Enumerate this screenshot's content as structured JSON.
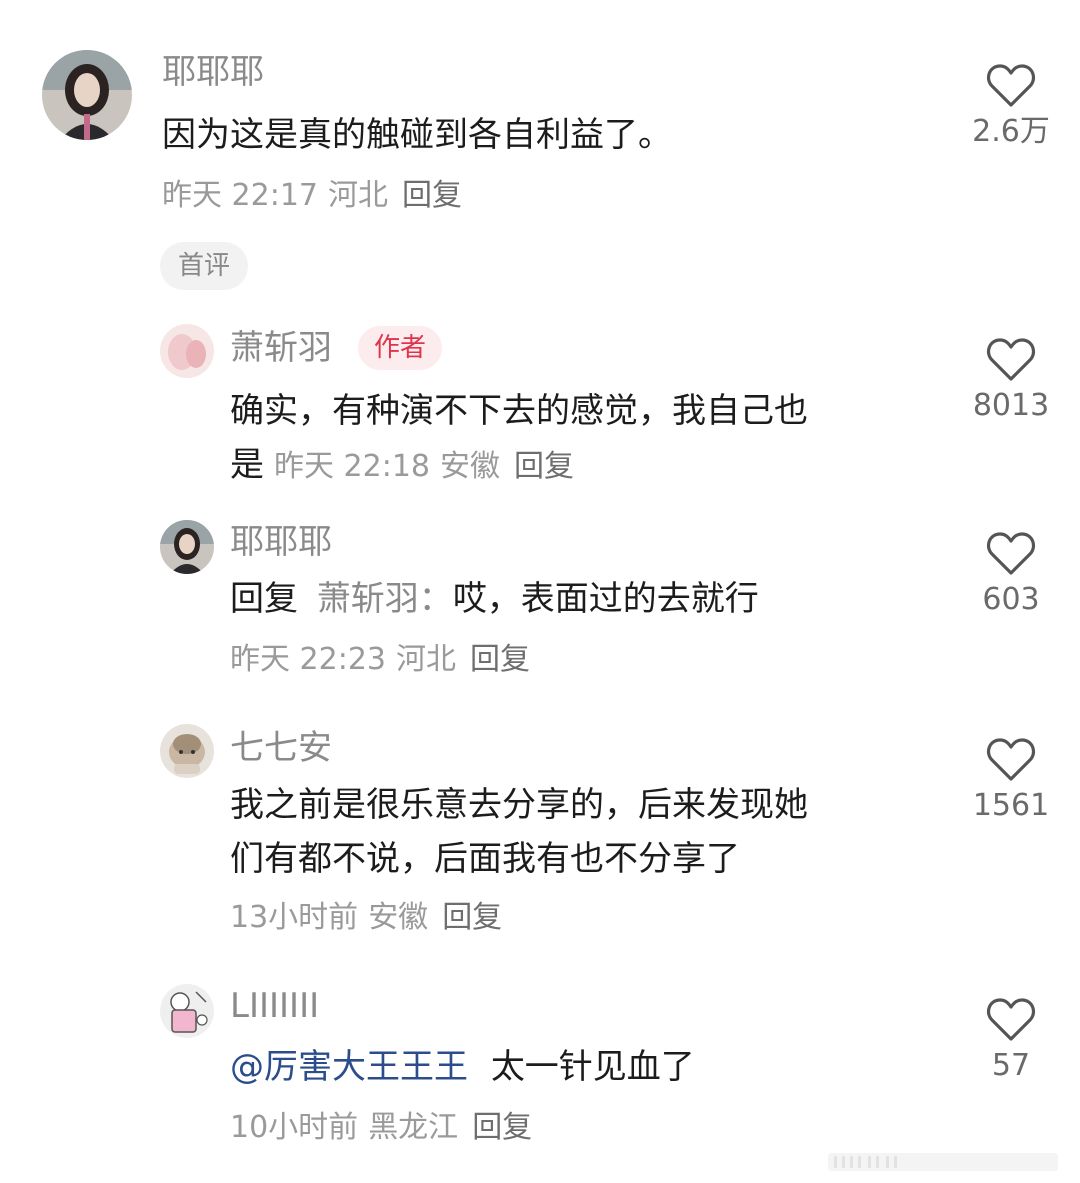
{
  "comments": [
    {
      "username": "耶耶耶",
      "text": "因为这是真的触碰到各自利益了。",
      "time": "昨天 22:17",
      "location": "河北",
      "reply_label": "回复",
      "likes": "2.6万",
      "tag": "首评"
    },
    {
      "username": "萧斩羽",
      "badge": "作者",
      "text_line1": "确实，有种演不下去的感觉，我自己也",
      "text_line2": "是",
      "time": "昨天 22:18",
      "location": "安徽",
      "reply_label": "回复",
      "likes": "8013"
    },
    {
      "username": "耶耶耶",
      "reply_prefix": "回复",
      "reply_target": "萧斩羽：",
      "text": "哎，表面过的去就行",
      "time": "昨天 22:23",
      "location": "河北",
      "reply_label": "回复",
      "likes": "603"
    },
    {
      "username": "七七安",
      "text_line1": "我之前是很乐意去分享的，后来发现她",
      "text_line2": "们有都不说，后面我有也不分享了",
      "time": "13小时前",
      "location": "安徽",
      "reply_label": "回复",
      "likes": "1561"
    },
    {
      "username": "LIIIIIII",
      "mention": "@厉害大王王王",
      "text": "太一针见血了",
      "time": "10小时前",
      "location": "黑龙江",
      "reply_label": "回复",
      "likes": "57"
    }
  ],
  "colors": {
    "name": "#8a8a8a",
    "text": "#1c1c1c",
    "meta": "#9a9a9a",
    "badge_bg": "#fdecee",
    "badge_text": "#e0344c",
    "mention": "#2b4d8c"
  },
  "icons": [
    "heart-outline-icon"
  ]
}
